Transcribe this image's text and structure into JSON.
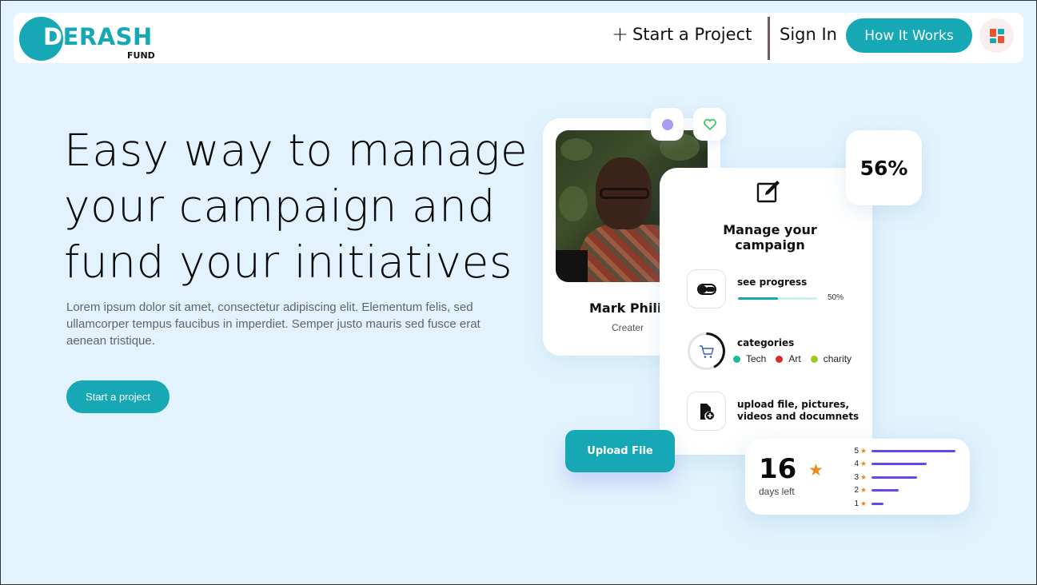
{
  "brand": {
    "first_letter": "D",
    "rest": "ERASH",
    "sub": "FUND"
  },
  "nav": {
    "start_project": "Start a Project",
    "sign_in": "Sign In",
    "how_it_works": "How It Works"
  },
  "hero": {
    "title_lines": [
      "Easy way to manage",
      "your campaign and",
      "fund your initiatives"
    ],
    "description": "Lorem ipsum dolor sit amet, consectetur adipiscing elit. Elementum felis, sed ullamcorper tempus faucibus in imperdiet. Semper justo mauris sed fusce erat aenean tristique.",
    "cta": "Start a project"
  },
  "profile": {
    "name": "Mark Philip",
    "role": "Creater"
  },
  "manage": {
    "title_line1": "Manage your",
    "title_line2": "campaign",
    "progress": {
      "label": "see progress",
      "value_text": "50%",
      "value": 0.5
    },
    "categories": {
      "label": "categories",
      "items": [
        {
          "name": "Tech",
          "color": "#1cb89a"
        },
        {
          "name": "Art",
          "color": "#d32f2f"
        },
        {
          "name": "charity",
          "color": "#9ccc1a"
        }
      ]
    },
    "upload": {
      "line1": "upload file, pictures,",
      "line2": "videos and documnets"
    }
  },
  "stats": {
    "percent": "56%"
  },
  "upload_button": "Upload File",
  "rating": {
    "days": "16",
    "days_label": "days left",
    "rows": [
      {
        "stars": "5",
        "fraction": 0.97
      },
      {
        "stars": "4",
        "fraction": 0.64
      },
      {
        "stars": "3",
        "fraction": 0.53
      },
      {
        "stars": "2",
        "fraction": 0.31
      },
      {
        "stars": "1",
        "fraction": 0.14
      }
    ]
  },
  "colors": {
    "accent": "#16a8b5",
    "background": "#e2f3fd",
    "bar": "#6a45ee",
    "star": "#e88c1a"
  }
}
